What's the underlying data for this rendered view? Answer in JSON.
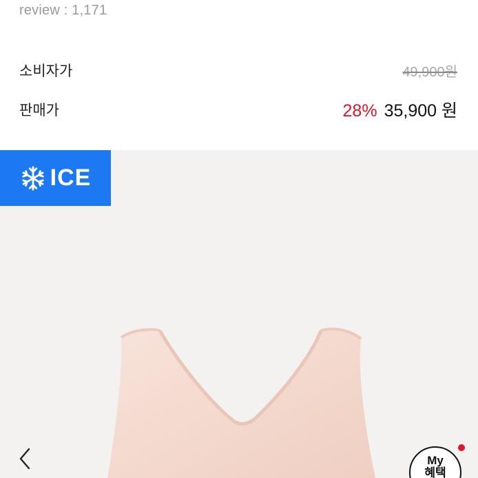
{
  "review": {
    "text": "review : 1,171"
  },
  "prices": {
    "consumer_label": "소비자가",
    "consumer_price": "49,900원",
    "sale_label": "판매가",
    "discount": "28%",
    "sale_price": "35,900 원"
  },
  "badge": {
    "text": "ICE",
    "icon": "snowflake-icon",
    "color": "#1c79f2"
  },
  "benefit": {
    "line1": "My",
    "line2": "혜택"
  },
  "colors": {
    "discount": "#e0162b",
    "background": "#f3f2f1",
    "garment": "#f6ddd2"
  }
}
